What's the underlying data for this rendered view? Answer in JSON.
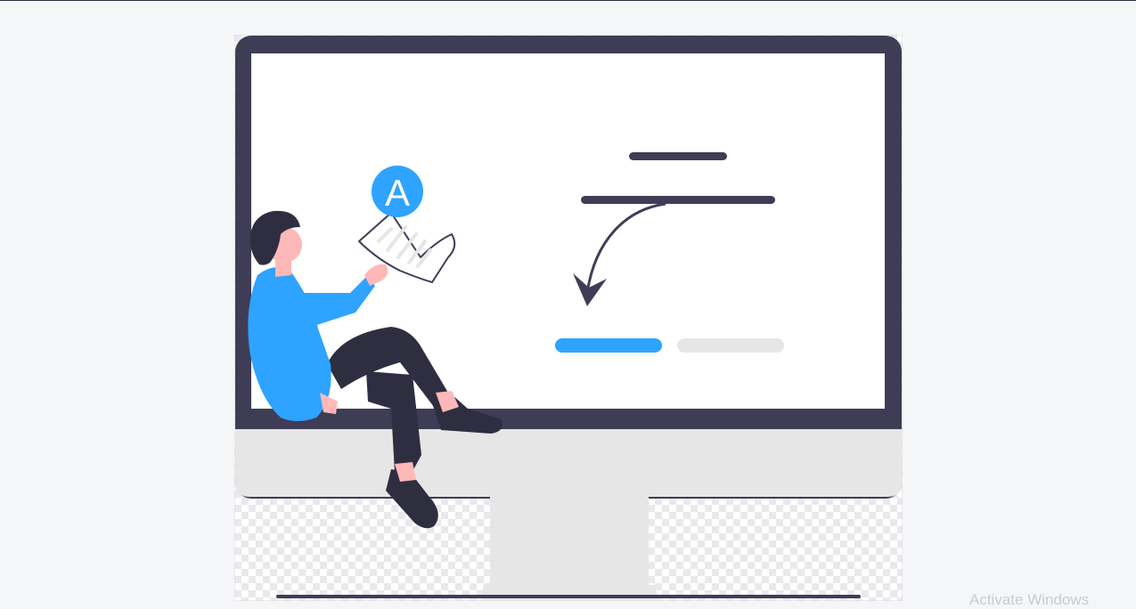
{
  "page": {
    "background_color": "#f5f6f8"
  },
  "illustration": {
    "name": "monitor-with-person-reading-document",
    "badge_letter": "A",
    "colors": {
      "monitor_frame": "#3f3d56",
      "screen": "#ffffff",
      "stand": "#e6e6e6",
      "accent": "#2ea3ff",
      "dark": "#2f2e41",
      "skin": "#ffb8b8",
      "light_bar": "#e6e6e6"
    }
  },
  "watermark": {
    "text": "Activate Windows"
  }
}
